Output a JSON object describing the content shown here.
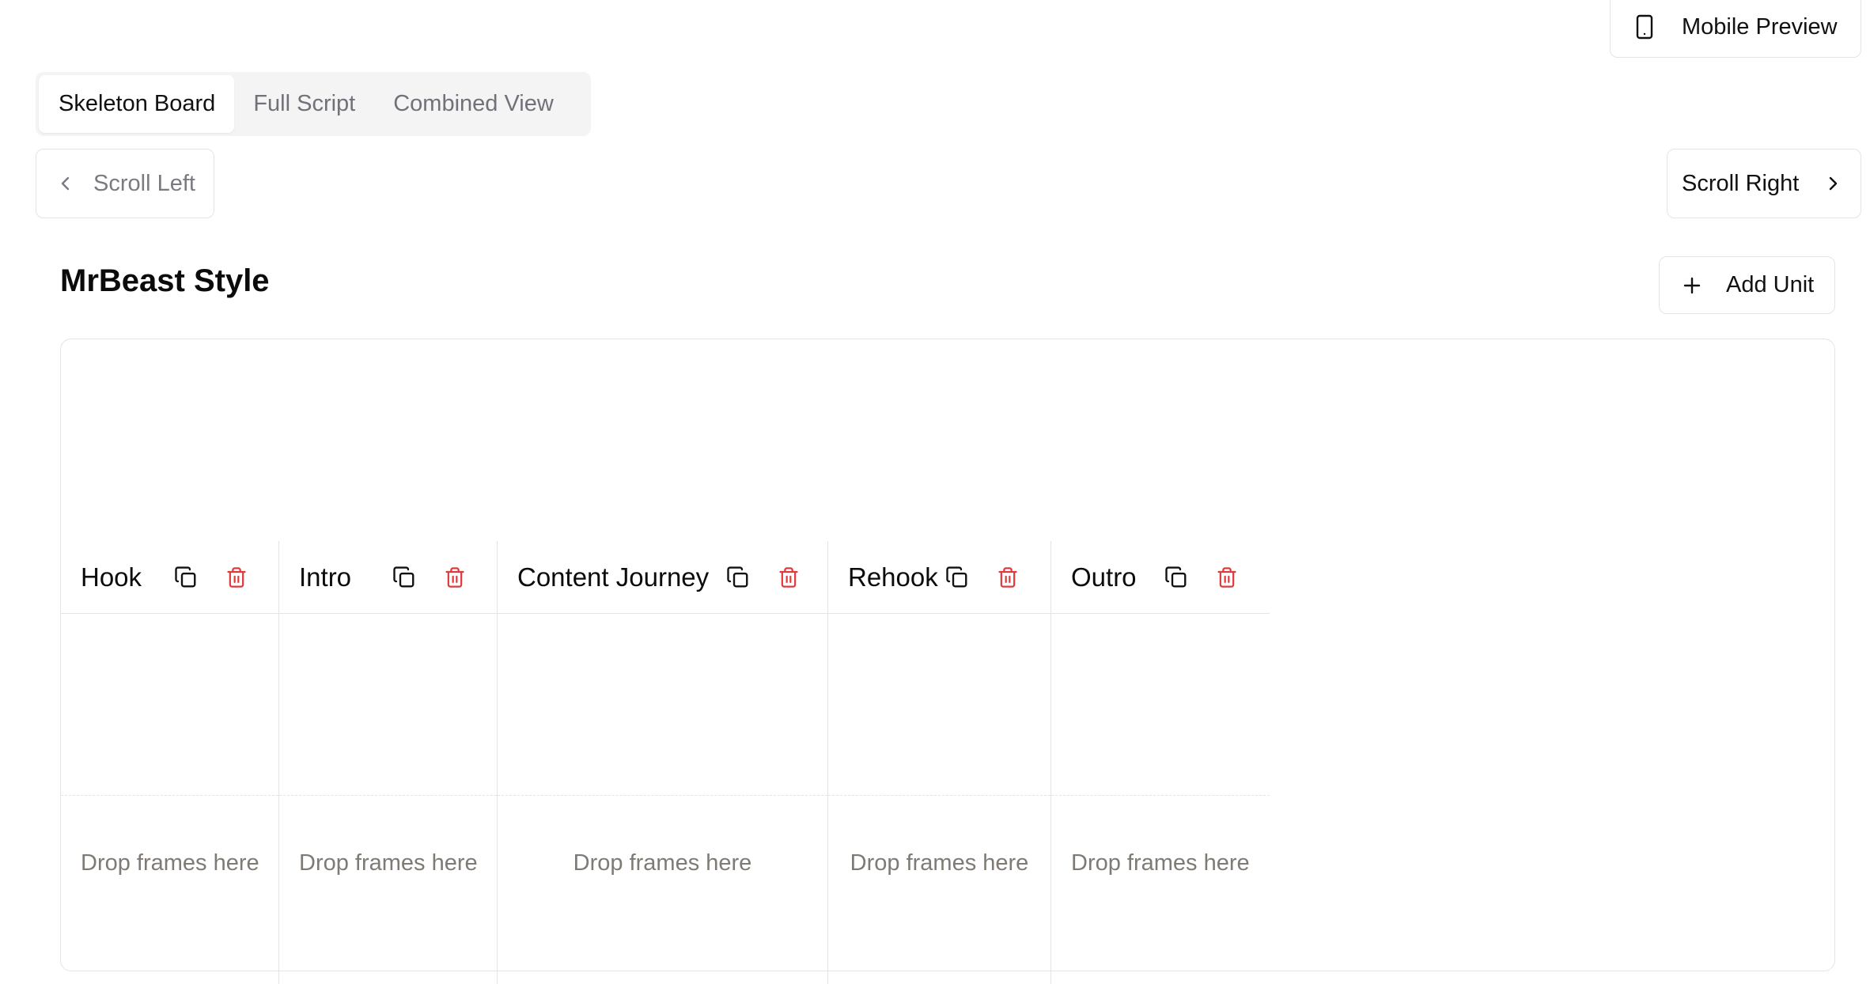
{
  "header": {
    "mobile_preview_label": "Mobile Preview"
  },
  "tabs": [
    {
      "label": "Skeleton Board",
      "active": true
    },
    {
      "label": "Full Script",
      "active": false
    },
    {
      "label": "Combined View",
      "active": false
    }
  ],
  "scroll": {
    "left_label": "Scroll Left",
    "right_label": "Scroll Right"
  },
  "board": {
    "title": "MrBeast Style",
    "add_unit_label": "Add Unit",
    "columns": [
      {
        "title": "Hook",
        "drop_text": "Drop frames here"
      },
      {
        "title": "Intro",
        "drop_text": "Drop frames here"
      },
      {
        "title": "Content Journey",
        "drop_text": "Drop frames here"
      },
      {
        "title": "Rehook",
        "drop_text": "Drop frames here"
      },
      {
        "title": "Outro",
        "drop_text": "Drop frames here"
      }
    ]
  },
  "colors": {
    "border": "#e4e4e7",
    "delete": "#dc3c3c",
    "muted_text": "#7f7a74",
    "tab_bg": "#f4f4f5"
  },
  "icons": {
    "mobile": "smartphone-icon",
    "scroll_left": "chevron-left-icon",
    "scroll_right": "chevron-right-icon",
    "add": "plus-icon",
    "duplicate": "copy-icon",
    "delete": "trash-icon"
  }
}
